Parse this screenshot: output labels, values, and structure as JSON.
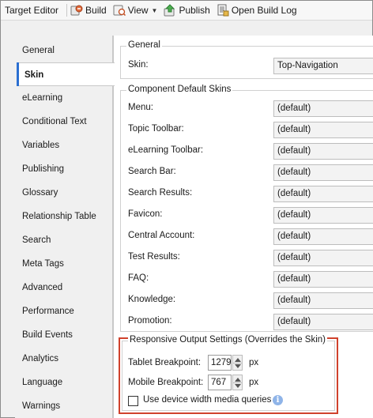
{
  "toolbar": {
    "title": "Target Editor",
    "build": "Build",
    "view": "View",
    "publish": "Publish",
    "open_build_log": "Open Build Log"
  },
  "sidebar": {
    "items": [
      {
        "label": "General"
      },
      {
        "label": "Skin"
      },
      {
        "label": "eLearning"
      },
      {
        "label": "Conditional Text"
      },
      {
        "label": "Variables"
      },
      {
        "label": "Publishing"
      },
      {
        "label": "Glossary"
      },
      {
        "label": "Relationship Table"
      },
      {
        "label": "Search"
      },
      {
        "label": "Meta Tags"
      },
      {
        "label": "Advanced"
      },
      {
        "label": "Performance"
      },
      {
        "label": "Build Events"
      },
      {
        "label": "Analytics"
      },
      {
        "label": "Language"
      },
      {
        "label": "Warnings"
      }
    ],
    "active_index": 1
  },
  "general": {
    "title": "General",
    "skin_label": "Skin:",
    "skin_value": "Top-Navigation"
  },
  "component_skins": {
    "title": "Component Default Skins",
    "rows": [
      {
        "label": "Menu:",
        "value": "(default)"
      },
      {
        "label": "Topic Toolbar:",
        "value": "(default)"
      },
      {
        "label": "eLearning Toolbar:",
        "value": "(default)"
      },
      {
        "label": "Search Bar:",
        "value": "(default)"
      },
      {
        "label": "Search Results:",
        "value": "(default)"
      },
      {
        "label": "Favicon:",
        "value": "(default)"
      },
      {
        "label": "Central Account:",
        "value": "(default)"
      },
      {
        "label": "Test Results:",
        "value": "(default)"
      },
      {
        "label": "FAQ:",
        "value": "(default)"
      },
      {
        "label": "Knowledge:",
        "value": "(default)"
      },
      {
        "label": "Promotion:",
        "value": "(default)"
      }
    ]
  },
  "responsive": {
    "title": "Responsive Output Settings (Overrides the Skin)",
    "tablet_label": "Tablet Breakpoint:",
    "tablet_value": "1279",
    "mobile_label": "Mobile Breakpoint:",
    "mobile_value": "767",
    "unit": "px",
    "media_queries_label": "Use device width media queries",
    "media_queries_checked": false
  },
  "colors": {
    "highlight_border": "#d0412c",
    "active_tab_marker": "#2b6fd1"
  }
}
